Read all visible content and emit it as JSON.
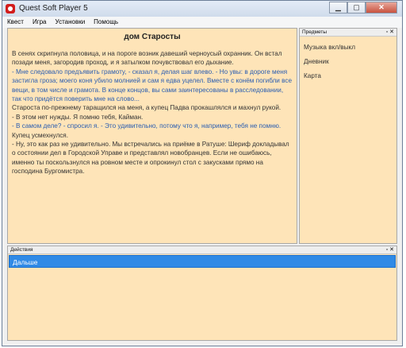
{
  "window": {
    "title": "Quest Soft Player 5",
    "minimize_label": "▁",
    "maximize_label": "▢",
    "close_label": "✕"
  },
  "menu": [
    "Квест",
    "Игра",
    "Установки",
    "Помощь"
  ],
  "main": {
    "room_title": "дом Старосты",
    "paragraphs": [
      "  В сенях скрипнула половица, и на пороге возник давеший черноусый охранник. Он встал позади меня, загородив проход, и я затылком почувствовал его дыхание.",
      "  - Мне следовало предъявить грамоту, - сказал я, делая шаг влево. - Но увы: в дороге меня застигла гроза; моего коня убило молнией и сам я едва уцелел. Вместе с конём погибли все вещи, в том числе и грамота. В конце концов, вы сами заинтересованы в расследовании, так что придётся поверить мне на слово...",
      "  Староста по-прежнему таращился на меня, а купец Падва прокашлялся и махнул рукой.",
      "  - В этом нет нужды. Я помню тебя, Кайман.",
      "  - В самом деле? - спросил я. - Это удивительно, потому что я, например, тебя не помню.",
      "  Купец усмехнулся.",
      "  - Ну, это как раз не удивительно. Мы встречались на приёме в Ратуше: Шериф докладывал о состоянии дел в Городской Управе и представлял новобранцев. Если не ошибаюсь, именно ты поскользнулся на ровном месте и опрокинул стол с закусками прямо на  господина Бургомистра."
    ]
  },
  "objects": {
    "header": "Предметы",
    "buttons": "▫ ✕",
    "items": [
      "Музыка вкл/выкл",
      "Дневник",
      "Карта"
    ]
  },
  "actions": {
    "header": "Действия",
    "buttons": "▫ ✕",
    "items": [
      "Дальше"
    ]
  },
  "colors": {
    "pane_bg": "#fee4b8",
    "dialog_text": "#2a5db0",
    "selected_action": "#2f8ae6"
  }
}
